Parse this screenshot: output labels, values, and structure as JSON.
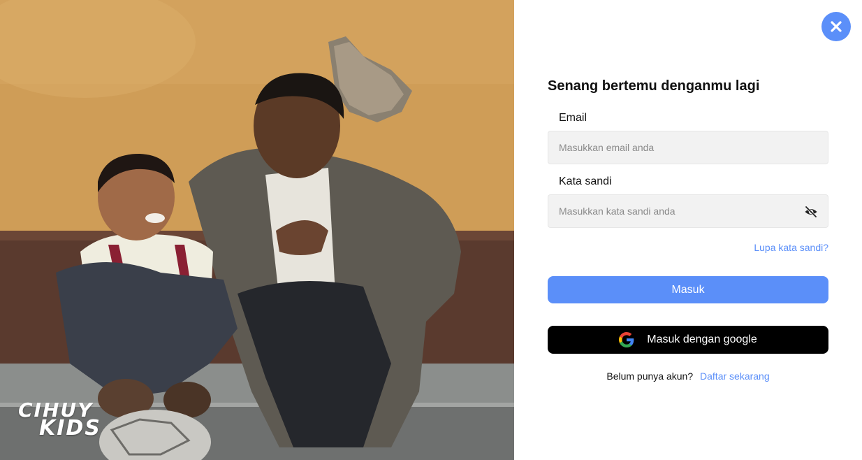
{
  "photo": {
    "alt": "Ayah dan anak tertawa duduk di tangga bersama bola"
  },
  "brand": {
    "line1": "CIHUY",
    "line2": "KIDS"
  },
  "close_icon": "close-icon",
  "form": {
    "title": "Senang bertemu denganmu lagi",
    "email": {
      "label": "Email",
      "placeholder": "Masukkan email anda",
      "value": ""
    },
    "password": {
      "label": "Kata sandi",
      "placeholder": "Masukkan kata sandi anda",
      "value": "",
      "toggle_icon": "eye-off-icon"
    },
    "forgot_link": "Lupa kata sandi?",
    "login_button": "Masuk",
    "google_button": "Masuk dengan google",
    "signup_prompt": "Belum punya akun?",
    "signup_link": "Daftar sekarang"
  },
  "colors": {
    "accent": "#5b8ff9",
    "google_button_bg": "#000000",
    "input_bg": "#f2f2f2"
  }
}
